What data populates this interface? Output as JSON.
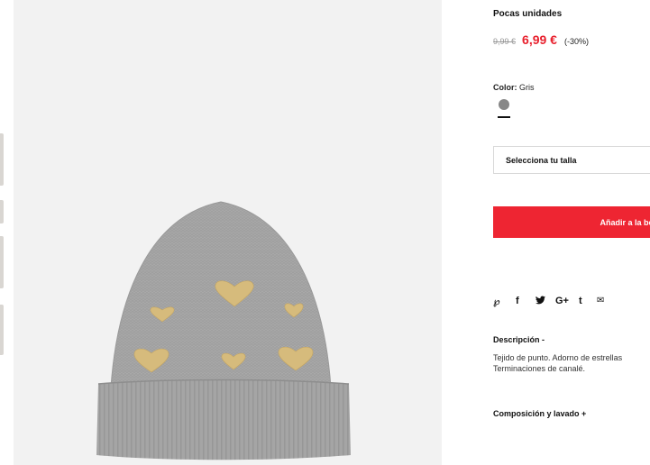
{
  "product": {
    "stock_status": "Pocas unidades",
    "old_price": "9,99 €",
    "new_price": "6,99 €",
    "discount": "(-30%)",
    "color": {
      "label": "Color:",
      "value": "Gris",
      "swatch_hex": "#878787"
    },
    "size_select": {
      "placeholder": "Selecciona tu talla"
    },
    "add_to_bag_label": "Añadir a la bo",
    "share_icons": [
      {
        "icon": "pinterest-icon",
        "glyph": "℘"
      },
      {
        "icon": "facebook-icon",
        "glyph": "f"
      },
      {
        "icon": "twitter-icon",
        "glyph": "🐦"
      },
      {
        "icon": "google-plus-icon",
        "glyph": "G+"
      },
      {
        "icon": "tumblr-icon",
        "glyph": "t"
      },
      {
        "icon": "email-icon",
        "glyph": "✉"
      }
    ],
    "description": {
      "title": "Descripción -",
      "lines": [
        "Tejido de punto. Adorno de estrellas",
        "Terminaciones de canalé."
      ]
    },
    "composition_title": "Composición y lavado +"
  },
  "image": {
    "alt": "beanie-hat-with-gold-hearts"
  },
  "colors": {
    "accent_red": "#ee2532",
    "price_red": "#e8212e",
    "hat_gray": "#a9a9a9",
    "heart_gold": "#d8bc7e"
  }
}
